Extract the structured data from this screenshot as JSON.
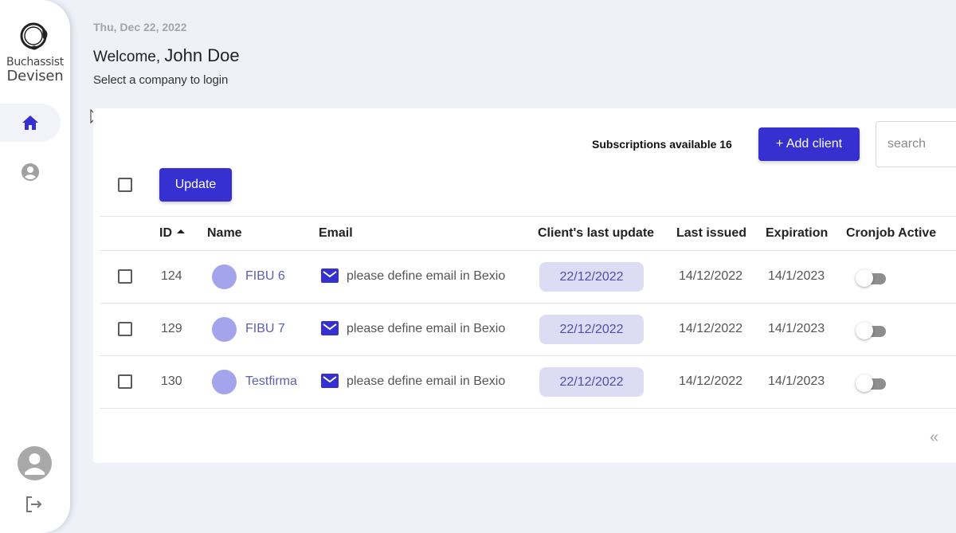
{
  "sidebar": {
    "logo": {
      "line1": "Buchassist",
      "line2": "Devisen",
      "icon": "headset-logo-icon"
    },
    "nav": [
      {
        "id": "home",
        "icon": "home-icon",
        "active": true
      },
      {
        "id": "profile",
        "icon": "user-circle-icon",
        "active": false
      }
    ],
    "bottom": {
      "avatar_icon": "avatar-icon",
      "logout_icon": "logout-icon"
    }
  },
  "header": {
    "date": "Thu, Dec 22, 2022",
    "welcome_prefix": "Welcome,",
    "user_name": "John Doe",
    "subtitle": "Select a company to login"
  },
  "toolbar": {
    "subscriptions_label": "Subscriptions available 16",
    "add_client_label": "+ Add client",
    "search_placeholder": "search",
    "search_value": "",
    "update_label": "Update"
  },
  "table": {
    "columns": [
      "ID",
      "Name",
      "Email",
      "Client's last update",
      "Last issued",
      "Expiration",
      "Cronjob Active"
    ],
    "sort": {
      "column": "ID",
      "direction": "asc"
    },
    "rows": [
      {
        "id": "124",
        "name": "FIBU 6",
        "email": "please define email in Bexio",
        "last_update": "22/12/2022",
        "last_issued": "14/12/2022",
        "expiration": "14/1/2023",
        "cronjob_active": false,
        "selected": false
      },
      {
        "id": "129",
        "name": "FIBU 7",
        "email": "please define email in Bexio",
        "last_update": "22/12/2022",
        "last_issued": "14/12/2022",
        "expiration": "14/1/2023",
        "cronjob_active": false,
        "selected": false
      },
      {
        "id": "130",
        "name": "Testfirma",
        "email": "please define email in Bexio",
        "last_update": "22/12/2022",
        "last_issued": "14/12/2022",
        "expiration": "14/1/2023",
        "cronjob_active": false,
        "selected": false
      }
    ]
  },
  "pagination": {
    "first_page_label": "«"
  },
  "colors": {
    "primary": "#3530cf",
    "chip_bg": "#dcdcf4",
    "chip_text": "#4f4ea8",
    "avatar_dot": "#a3a5ec",
    "page_bg": "#eef1f7"
  }
}
